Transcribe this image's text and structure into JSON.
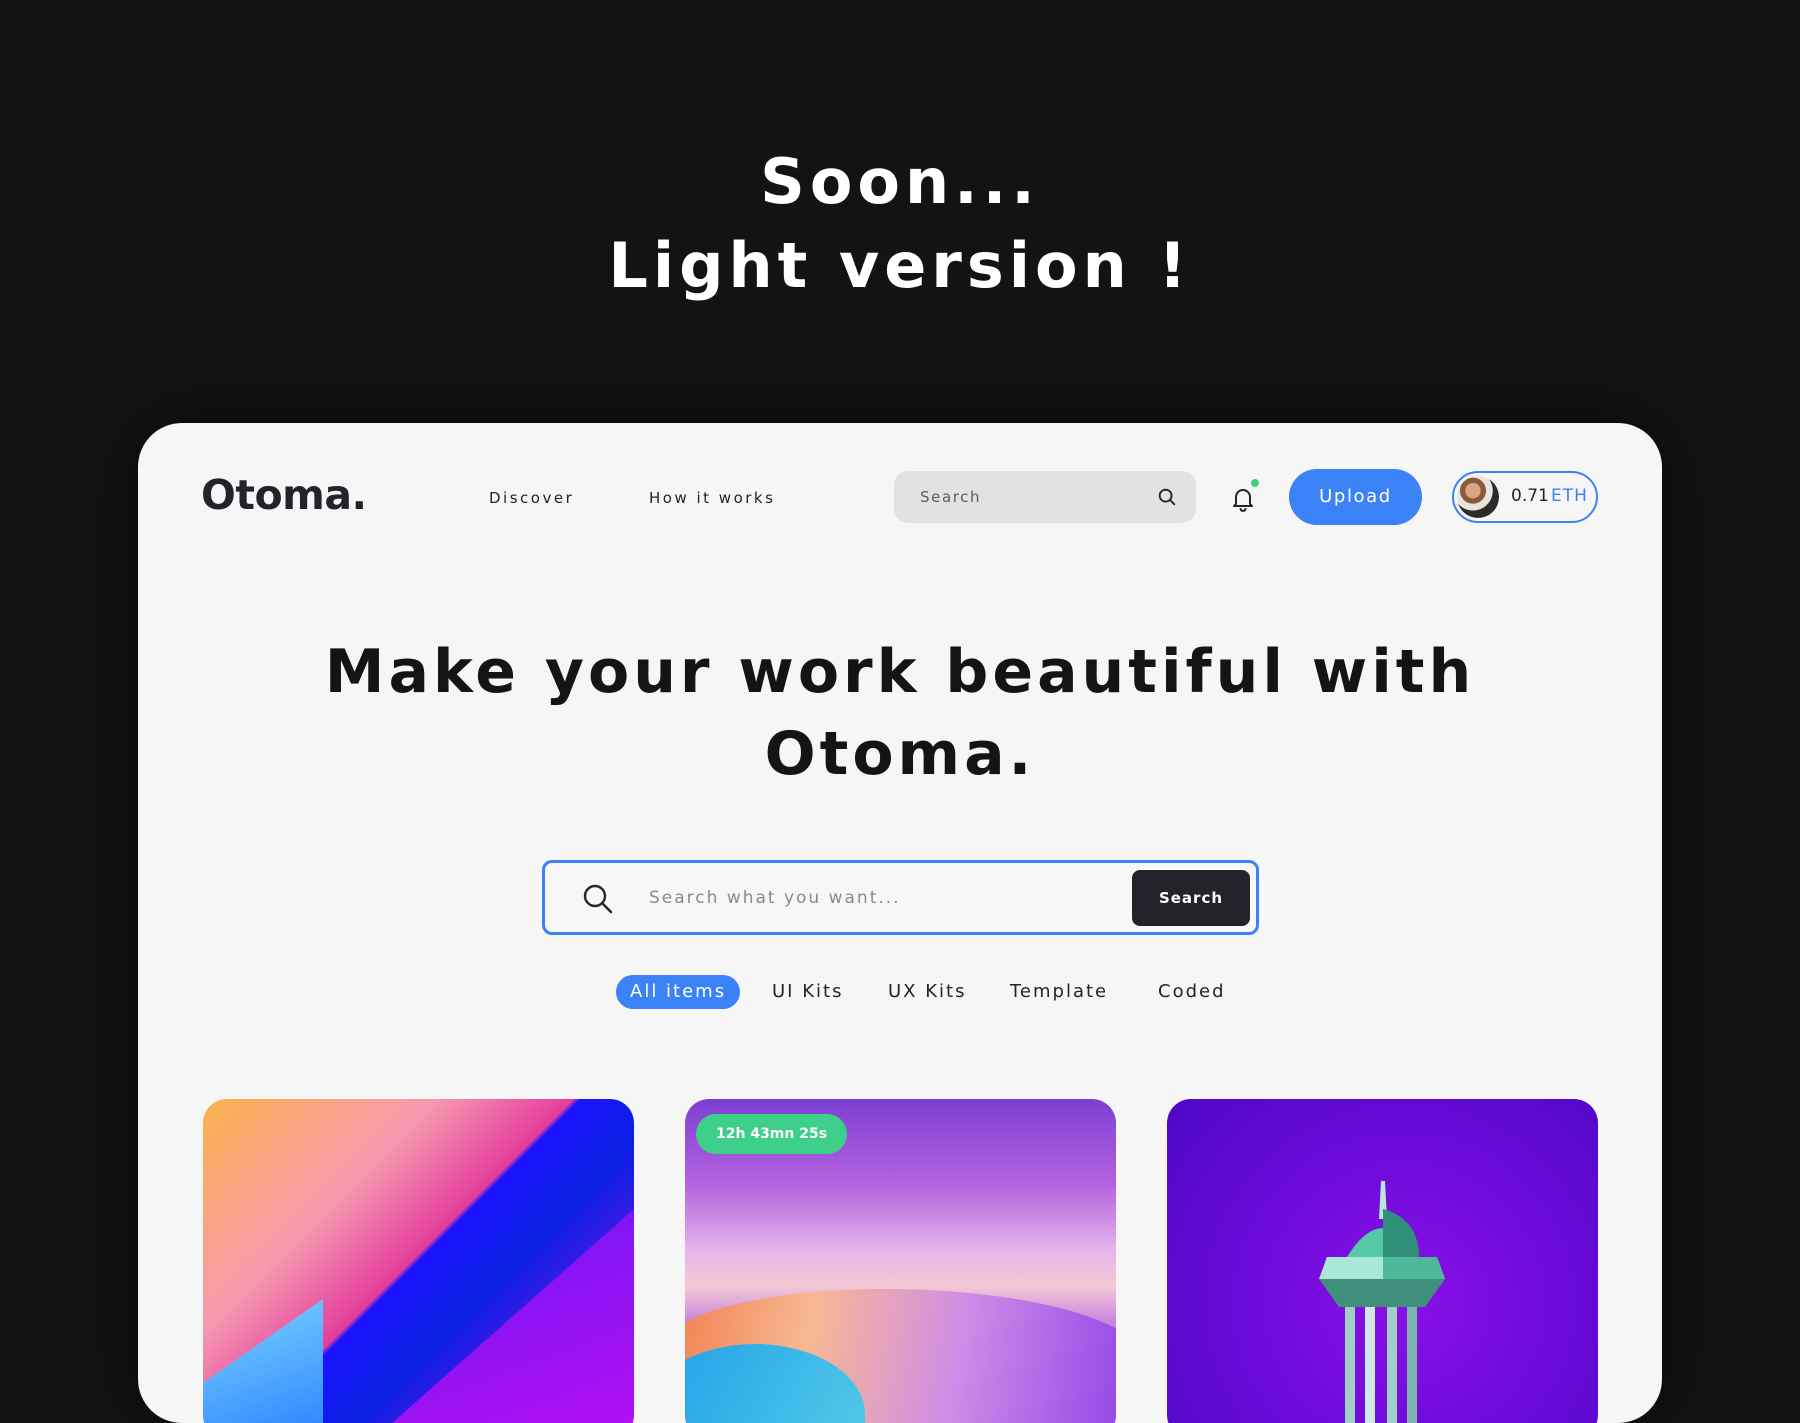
{
  "promo": {
    "line1": "Soon...",
    "line2": "Light version !"
  },
  "header": {
    "logo": "Otoma.",
    "nav": [
      "Discover",
      "How it works"
    ],
    "search_placeholder": "Search",
    "upload_label": "Upload",
    "wallet": {
      "amount": "0.71",
      "unit": "ETH"
    },
    "notification_indicator_color": "#3fd27f"
  },
  "hero": {
    "title_line1": "Make your work beautiful with",
    "title_line2": "Otoma.",
    "search_placeholder": "Search what you want...",
    "search_button": "Search"
  },
  "filters": {
    "items": [
      "All items",
      "UI Kits",
      "UX Kits",
      "Template",
      "Coded"
    ],
    "selected": "All items"
  },
  "cards": [
    {
      "timer": ""
    },
    {
      "timer": "12h 43mn 25s"
    },
    {
      "timer": ""
    }
  ],
  "colors": {
    "accent": "#3b82f6",
    "background_dark": "#131314",
    "panel": "#f6f6f6",
    "timer_badge": "#3ed08a",
    "dark_button": "#23242b"
  },
  "icons": {
    "top_search": "search-icon",
    "notification": "bell-icon",
    "hero_search": "search-icon"
  }
}
